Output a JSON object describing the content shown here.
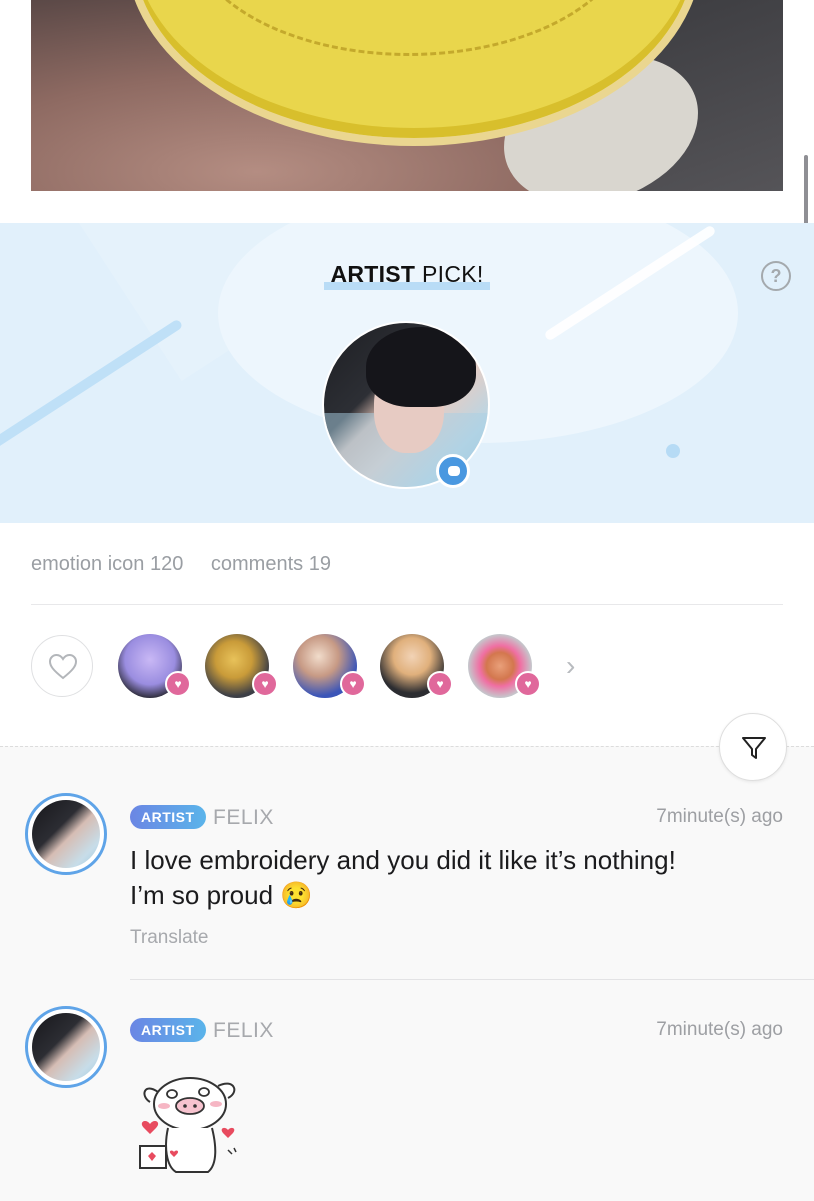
{
  "banner": {
    "title_bold": "ARTIST",
    "title_rest": " PICK!",
    "help": "?"
  },
  "stats": {
    "emotion": "emotion icon 120",
    "comments": "comments 19"
  },
  "reactions": {
    "heart_glyph": "♥",
    "more": "›"
  },
  "comments": [
    {
      "badge": "ARTIST",
      "name": "FELIX",
      "time": "7minute(s) ago",
      "line1": "I love embroidery and you did it like it’s nothing!",
      "line2": "I’m so proud 😢",
      "translate": "Translate"
    },
    {
      "badge": "ARTIST",
      "name": "FELIX",
      "time": "7minute(s) ago",
      "sticker": "pig-sticker"
    }
  ],
  "colors": {
    "banner_bg": "#e1f0fb",
    "badge_gradient_start": "#6b86e4",
    "badge_gradient_end": "#5ab4ea",
    "heart_badge": "#e0689b",
    "chat_badge": "#4a98e0"
  }
}
